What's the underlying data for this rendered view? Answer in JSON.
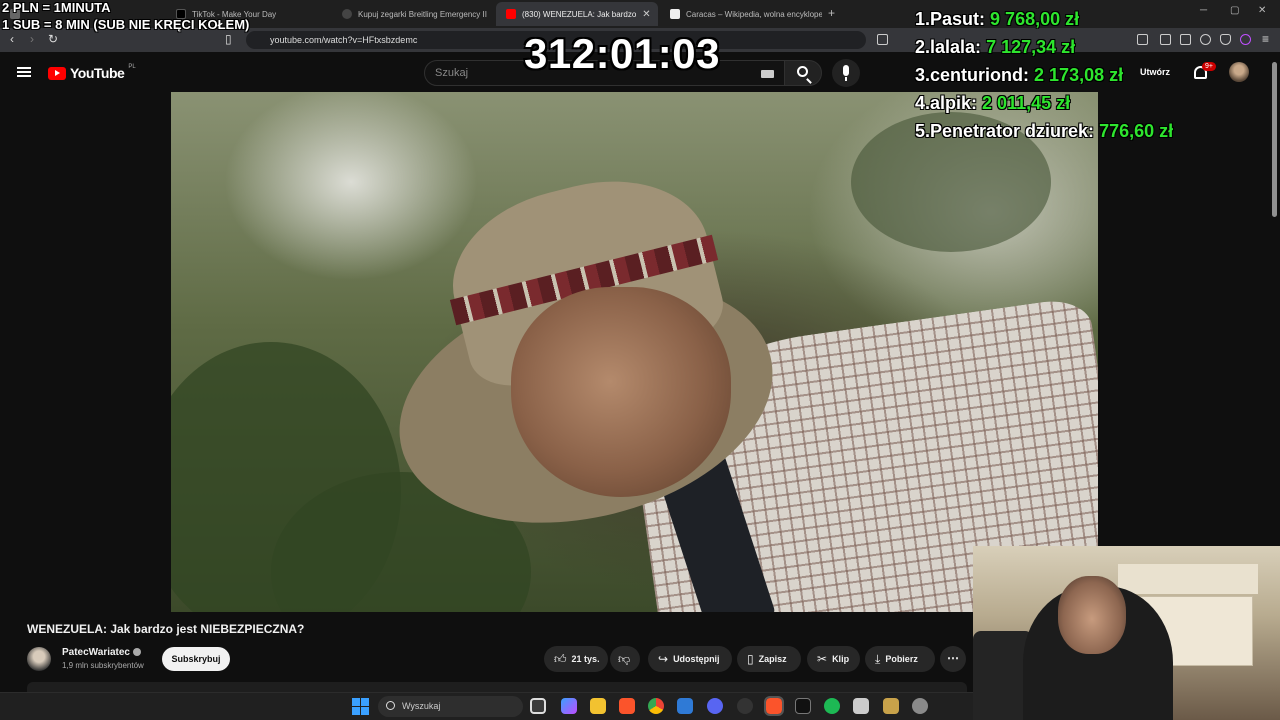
{
  "browser": {
    "tabs": [
      {
        "label": "",
        "active": false
      },
      {
        "label": "TikTok - Make Your Day",
        "active": false
      },
      {
        "label": "Kupuj zegarki Breitling Emergency II",
        "active": false
      },
      {
        "label": "(830) WENEZUELA: Jak bardzo",
        "active": true
      },
      {
        "label": "Caracas – Wikipedia, wolna encyklopedia",
        "active": false
      }
    ],
    "url": "youtube.com/watch?v=HFtxsbzdemc"
  },
  "youtube": {
    "logo_text": "YouTube",
    "region": "PL",
    "search_placeholder": "Szukaj",
    "create_label": "Utwórz",
    "notifications_badge": "9+"
  },
  "video": {
    "title": "WENEZUELA: Jak bardzo jest NIEBEZPIECZNA?",
    "channel_name": "PatecWariatec",
    "channel_subs": "1,9 mln subskrybentów",
    "subscribe_label": "Subskrybuj",
    "likes": "21 tys.",
    "share_label": "Udostępnij",
    "save_label": "Zapisz",
    "clip_label": "Klip",
    "download_label": "Pobierz"
  },
  "overlay": {
    "donation_rule_1": "2 PLN = 1MINUTA",
    "donation_rule_2": "1 SUB = 8 MIN (SUB NIE KRĘCI KOŁEM)",
    "timer": "312:01:03",
    "leaderboard": [
      {
        "rank": "1.",
        "name": "Pasut:",
        "amount": "9 768,00 zł"
      },
      {
        "rank": "2.",
        "name": "lalala:",
        "amount": "7 127,34 zł"
      },
      {
        "rank": "3.",
        "name": "centuriond:",
        "amount": "2 173,08 zł"
      },
      {
        "rank": "4.",
        "name": "alpik:",
        "amount": "2 011,45 zł"
      },
      {
        "rank": "5.",
        "name": "Penetrator dziurek:",
        "amount": "776,60 zł"
      }
    ]
  },
  "taskbar": {
    "search_placeholder": "Wyszukaj"
  },
  "colors": {
    "accent_red": "#ff0000",
    "leaderboard_amount": "#2ee52e",
    "background": "#0f0f0f"
  }
}
